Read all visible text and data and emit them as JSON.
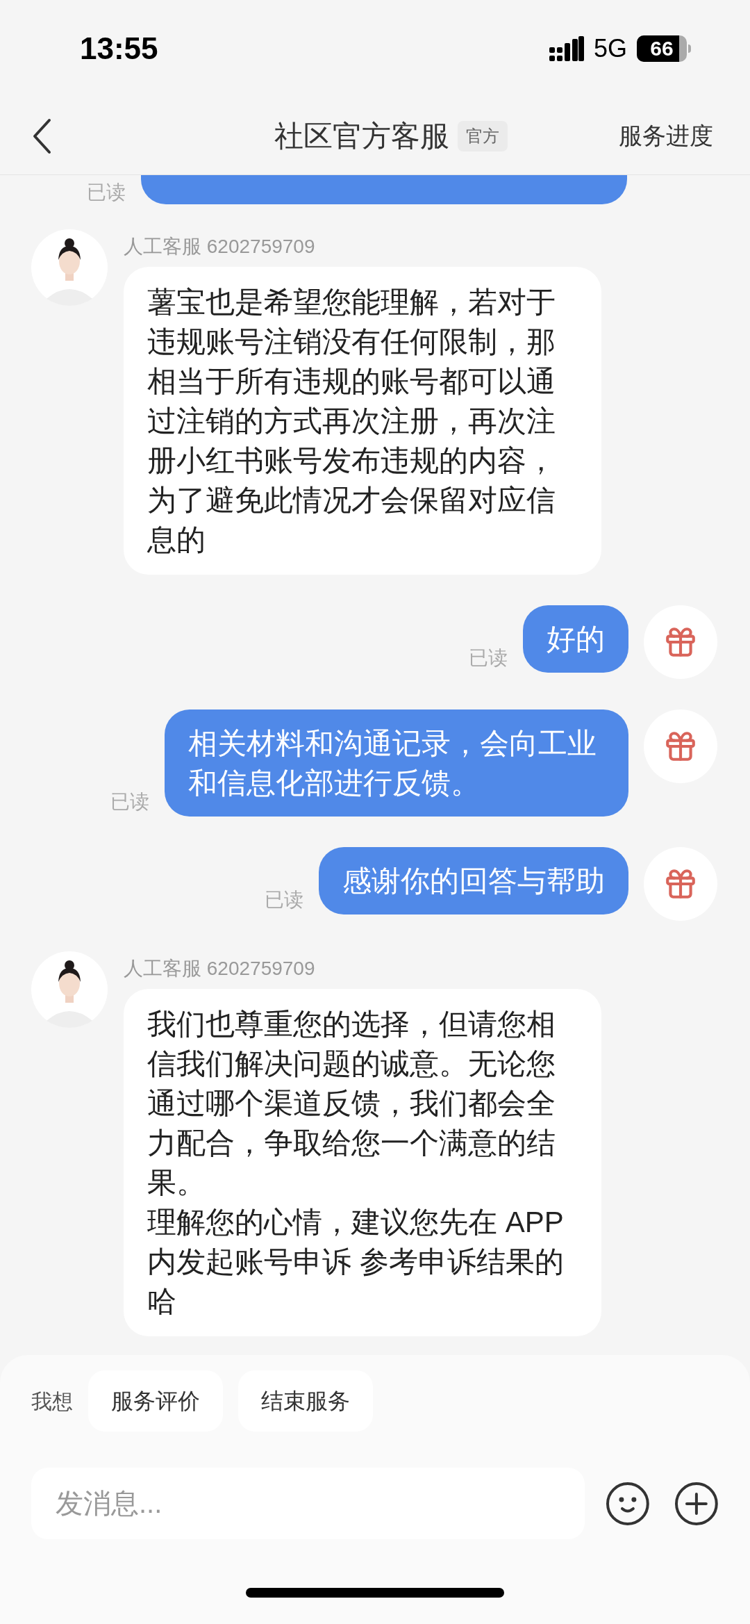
{
  "status_bar": {
    "time": "13:55",
    "network": "5G",
    "battery": "66"
  },
  "header": {
    "title": "社区官方客服",
    "badge": "官方",
    "action": "服务进度"
  },
  "messages": [
    {
      "kind": "user",
      "partial": true,
      "read": "已读"
    },
    {
      "kind": "agent",
      "partial": false,
      "sender": "人工客服 6202759709",
      "paragraphs": [
        "薯宝也是希望您能理解，若对于违规账号注销没有任何限制，那相当于所有违规的账号都可以通过注销的方式再次注册，再次注册小红书账号发布违规的内容，为了避免此情况才会保留对应信息的"
      ]
    },
    {
      "kind": "user",
      "partial": false,
      "text": "好的",
      "read": "已读"
    },
    {
      "kind": "user",
      "partial": false,
      "text": "相关材料和沟通记录，会向工业和信息化部进行反馈。",
      "read": "已读"
    },
    {
      "kind": "user",
      "partial": false,
      "text": "感谢你的回答与帮助",
      "read": "已读"
    },
    {
      "kind": "agent",
      "partial": false,
      "sender": "人工客服 6202759709",
      "paragraphs": [
        "我们也尊重您的选择，但请您相信我们解决问题的诚意。无论您通过哪个渠道反馈，我们都会全力配合，争取给您一个满意的结果。",
        "理解您的心情，建议您先在 APP 内发起账号申诉 参考申诉结果的哈"
      ]
    }
  ],
  "quick_replies": {
    "label": "我想",
    "options": [
      "服务评价",
      "结束服务"
    ]
  },
  "composer": {
    "placeholder": "发消息..."
  }
}
